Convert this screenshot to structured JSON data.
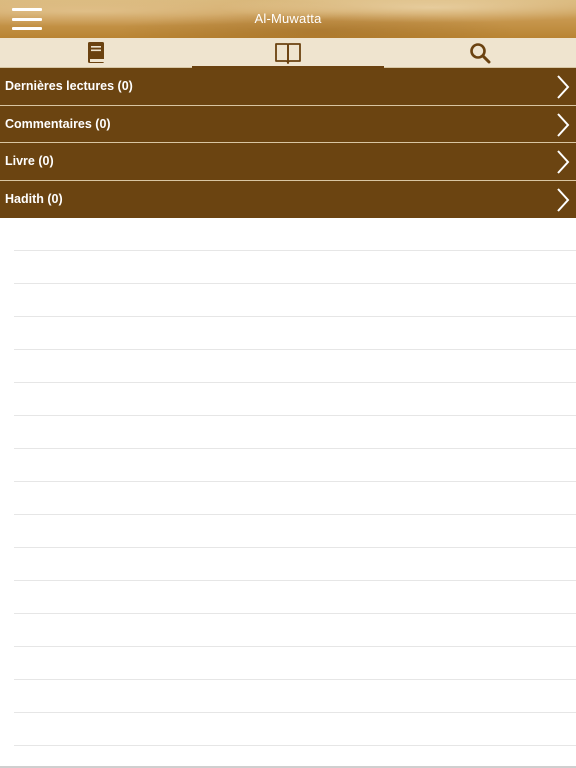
{
  "nav": {
    "title": "Al-Muwatta",
    "menu_icon": "hamburger-menu-icon"
  },
  "tabs": [
    {
      "icon": "book-icon",
      "active": false
    },
    {
      "icon": "open-book-icon",
      "active": true
    },
    {
      "icon": "search-icon",
      "active": false
    }
  ],
  "menu": {
    "items": [
      {
        "label": "Dernières lectures (0)"
      },
      {
        "label": "Commentaires (0)"
      },
      {
        "label": "Livre (0)"
      },
      {
        "label": "Hadith (0)"
      }
    ]
  },
  "colors": {
    "row_bg": "#6b4411",
    "tab_bar_bg": "#efe4cf",
    "accent": "#6b4210",
    "nav_gradient": "#c99a52"
  }
}
